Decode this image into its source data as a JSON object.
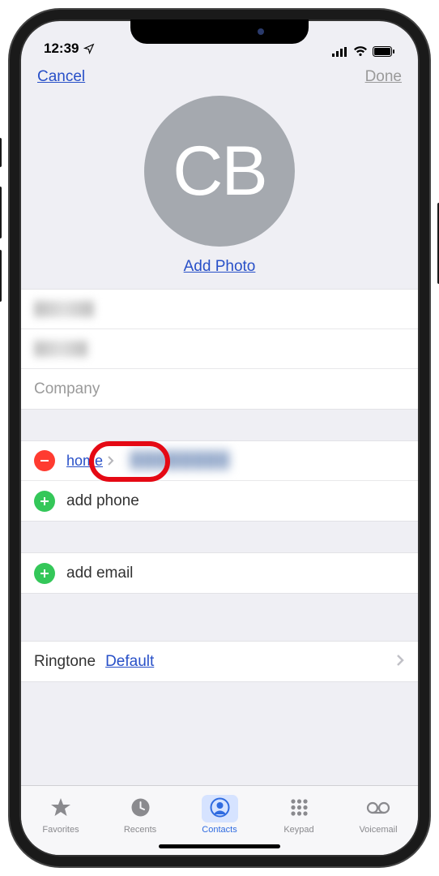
{
  "statusbar": {
    "time": "12:39"
  },
  "nav": {
    "cancel": "Cancel",
    "done": "Done"
  },
  "contact": {
    "initials": "CB",
    "add_photo": "Add Photo",
    "company_placeholder": "Company"
  },
  "phone_section": {
    "type_label": "home",
    "add_phone": "add phone"
  },
  "email_section": {
    "add_email": "add email"
  },
  "ringtone": {
    "label": "Ringtone",
    "value": "Default"
  },
  "tabs": {
    "favorites": "Favorites",
    "recents": "Recents",
    "contacts": "Contacts",
    "keypad": "Keypad",
    "voicemail": "Voicemail"
  }
}
